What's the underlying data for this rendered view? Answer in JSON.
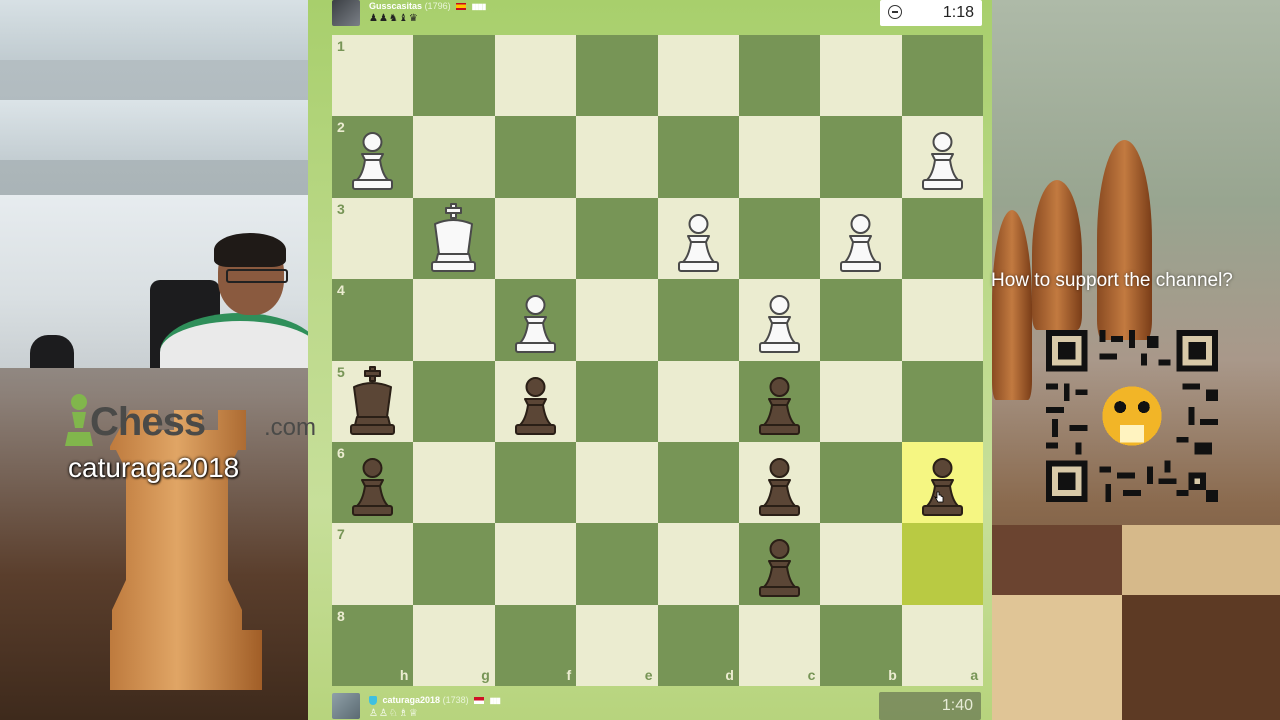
{
  "top_player": {
    "name": "Gusscasitas",
    "rating": "(1796)",
    "captured": "♟♟♞♝♛",
    "clock": "1:18"
  },
  "bottom_player": {
    "name": "caturaga2018",
    "rating": "(1738)",
    "captured": "♙♙♘♗♕",
    "clock": "1:40"
  },
  "board": {
    "orientation": "black-bottom",
    "ranks": [
      "1",
      "2",
      "3",
      "4",
      "5",
      "6",
      "7",
      "8"
    ],
    "files": [
      "h",
      "g",
      "f",
      "e",
      "d",
      "c",
      "b",
      "a"
    ],
    "highlight": {
      "last_move_from": "a7",
      "last_move_to": "a6"
    },
    "pieces": [
      {
        "square": "h2",
        "piece": "white-pawn"
      },
      {
        "square": "a2",
        "piece": "white-pawn"
      },
      {
        "square": "g3",
        "piece": "white-king"
      },
      {
        "square": "d3",
        "piece": "white-pawn"
      },
      {
        "square": "b3",
        "piece": "white-pawn"
      },
      {
        "square": "f4",
        "piece": "white-pawn"
      },
      {
        "square": "c4",
        "piece": "white-pawn"
      },
      {
        "square": "h5",
        "piece": "black-king"
      },
      {
        "square": "f5",
        "piece": "black-pawn"
      },
      {
        "square": "c5",
        "piece": "black-pawn"
      },
      {
        "square": "h6",
        "piece": "black-pawn"
      },
      {
        "square": "c6",
        "piece": "black-pawn"
      },
      {
        "square": "a6",
        "piece": "black-pawn"
      },
      {
        "square": "c7",
        "piece": "black-pawn"
      }
    ]
  },
  "branding": {
    "logo_text": "Chess",
    "logo_suffix": ".com",
    "username": "caturaga2018"
  },
  "support": {
    "text": "How to support the channel?"
  },
  "colors": {
    "light_square": "#ebecd0",
    "dark_square": "#779556",
    "last_move_to": "#f5f682",
    "last_move_from": "#b9ca43"
  }
}
